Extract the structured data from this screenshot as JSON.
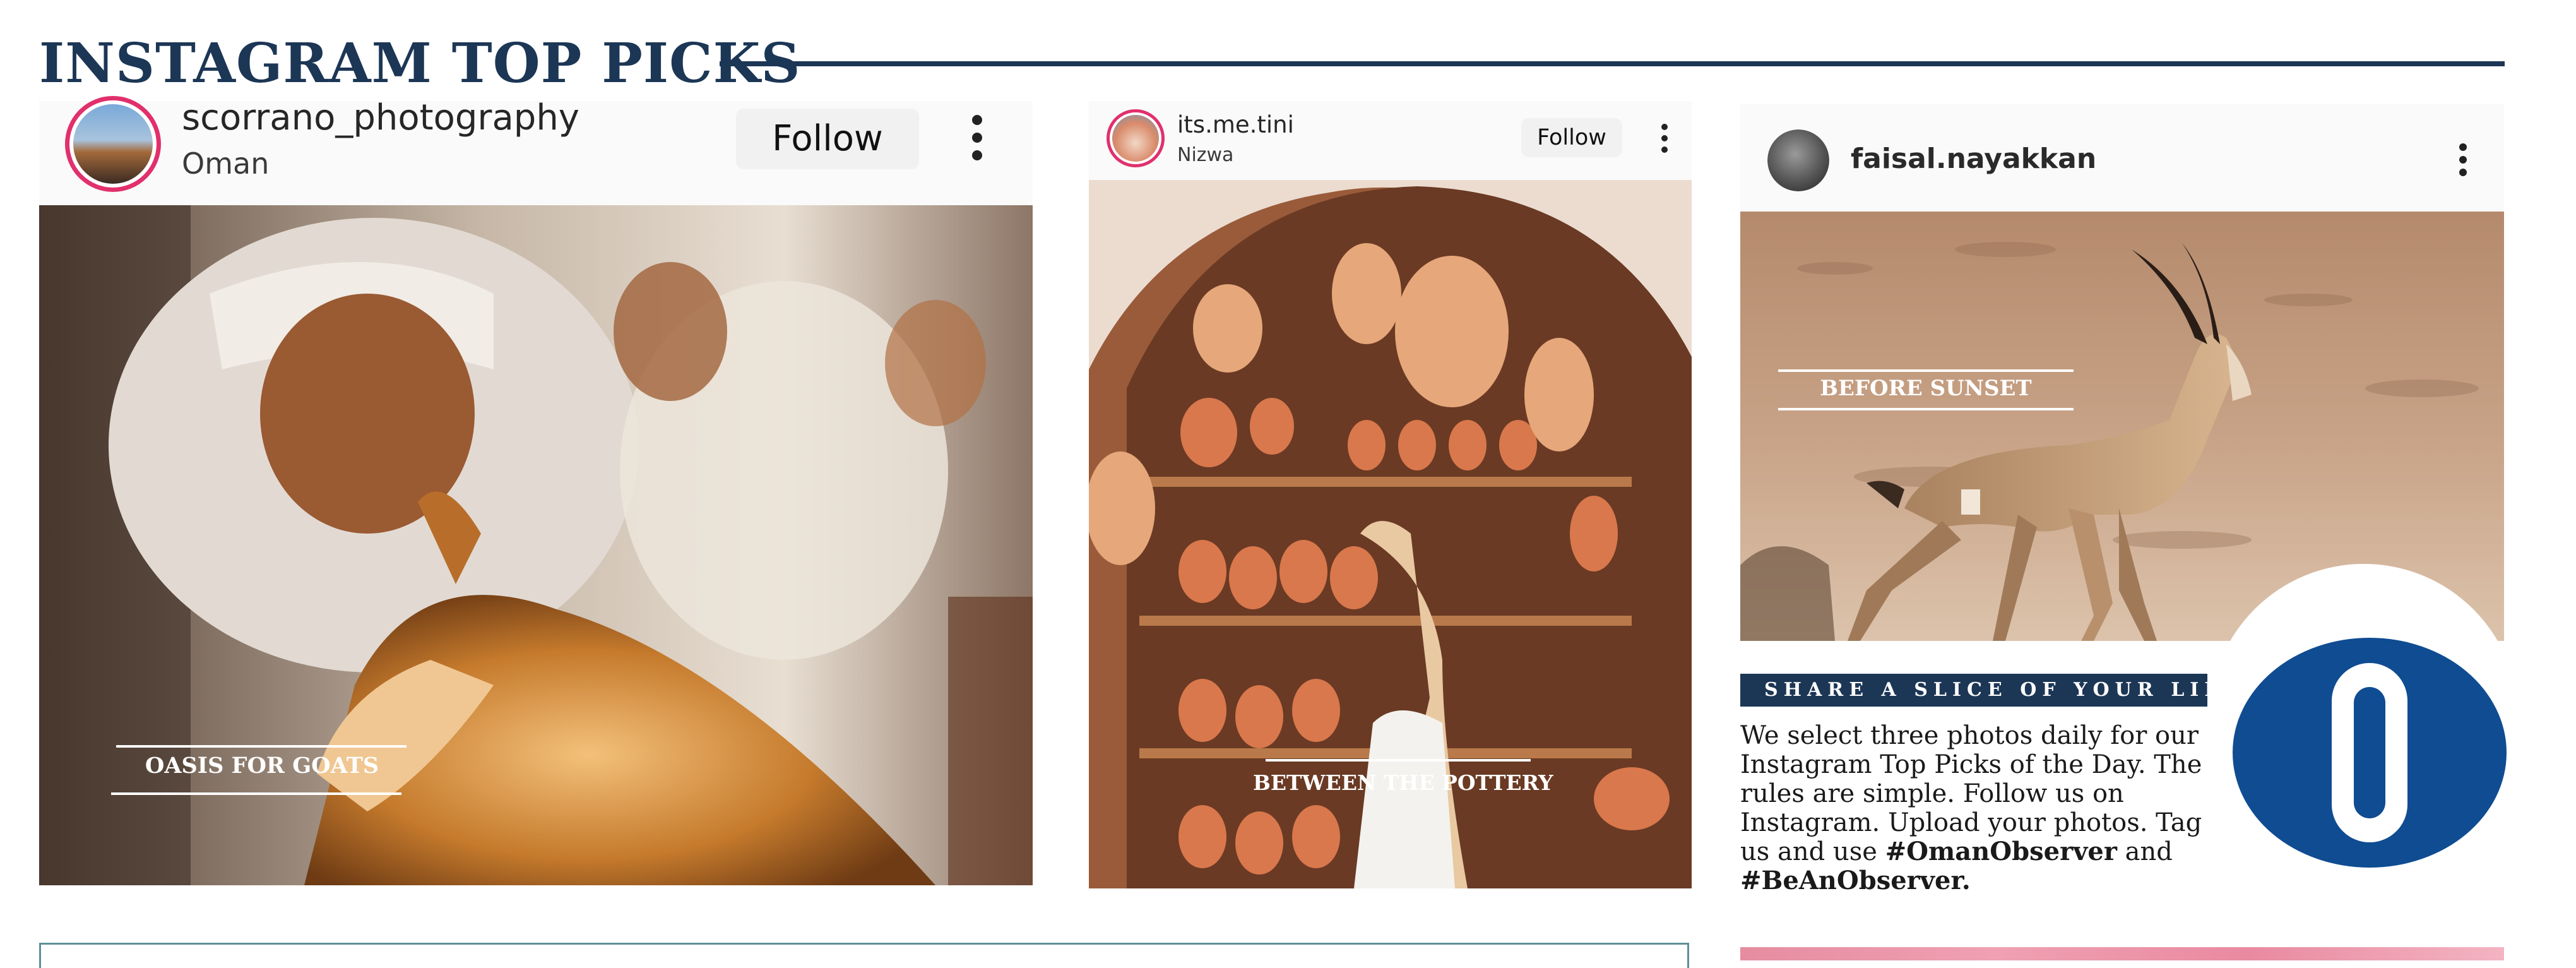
{
  "page": {
    "title": "INSTAGRAM TOP PICKS"
  },
  "posts": [
    {
      "username": "scorrano_photography",
      "location": "Oman",
      "follow_label": "Follow",
      "caption": "OASIS FOR GOATS"
    },
    {
      "username": "its.me.tini",
      "location": "Nizwa",
      "follow_label": "Follow",
      "caption": "BETWEEN THE POTTERY"
    },
    {
      "username": "faisal.nayakkan",
      "caption": "BEFORE SUNSET"
    }
  ],
  "share": {
    "heading": "SHARE A SLICE OF YOUR LIFE",
    "body": "We select three photos daily for our Instagram Top Picks of the Day. The rules are simple. Follow us on Instagram. Upload your photos. Tag us and use",
    "hashtag1": "#OmanObserver",
    "and": "and",
    "hashtag2": "#BeAnObserver."
  },
  "logo": {
    "letter": "O",
    "color": "#0f4c92"
  },
  "colors": {
    "navy": "#1c3655",
    "instagram_ring": "#e1306c",
    "logo_blue": "#0f4c92"
  },
  "icons": [
    "kebab-menu-icon",
    "avatar-image"
  ]
}
